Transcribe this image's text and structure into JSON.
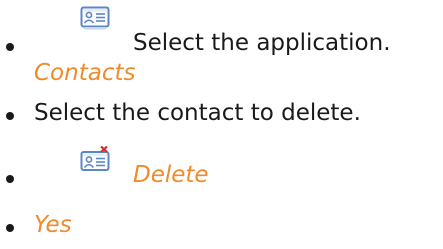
{
  "steps": [
    {
      "icon": "contact-card-icon",
      "text": "Select the application.",
      "sub_text": "Contacts"
    },
    {
      "text": "Select the contact to delete."
    },
    {
      "icon": "delete-contact-icon",
      "text": "Delete"
    },
    {
      "text": "Yes"
    }
  ],
  "colors": {
    "text": "#1a1a1a",
    "accent": "#f08a2a",
    "icon_blue": "#5b86c8",
    "icon_red": "#d23030"
  }
}
